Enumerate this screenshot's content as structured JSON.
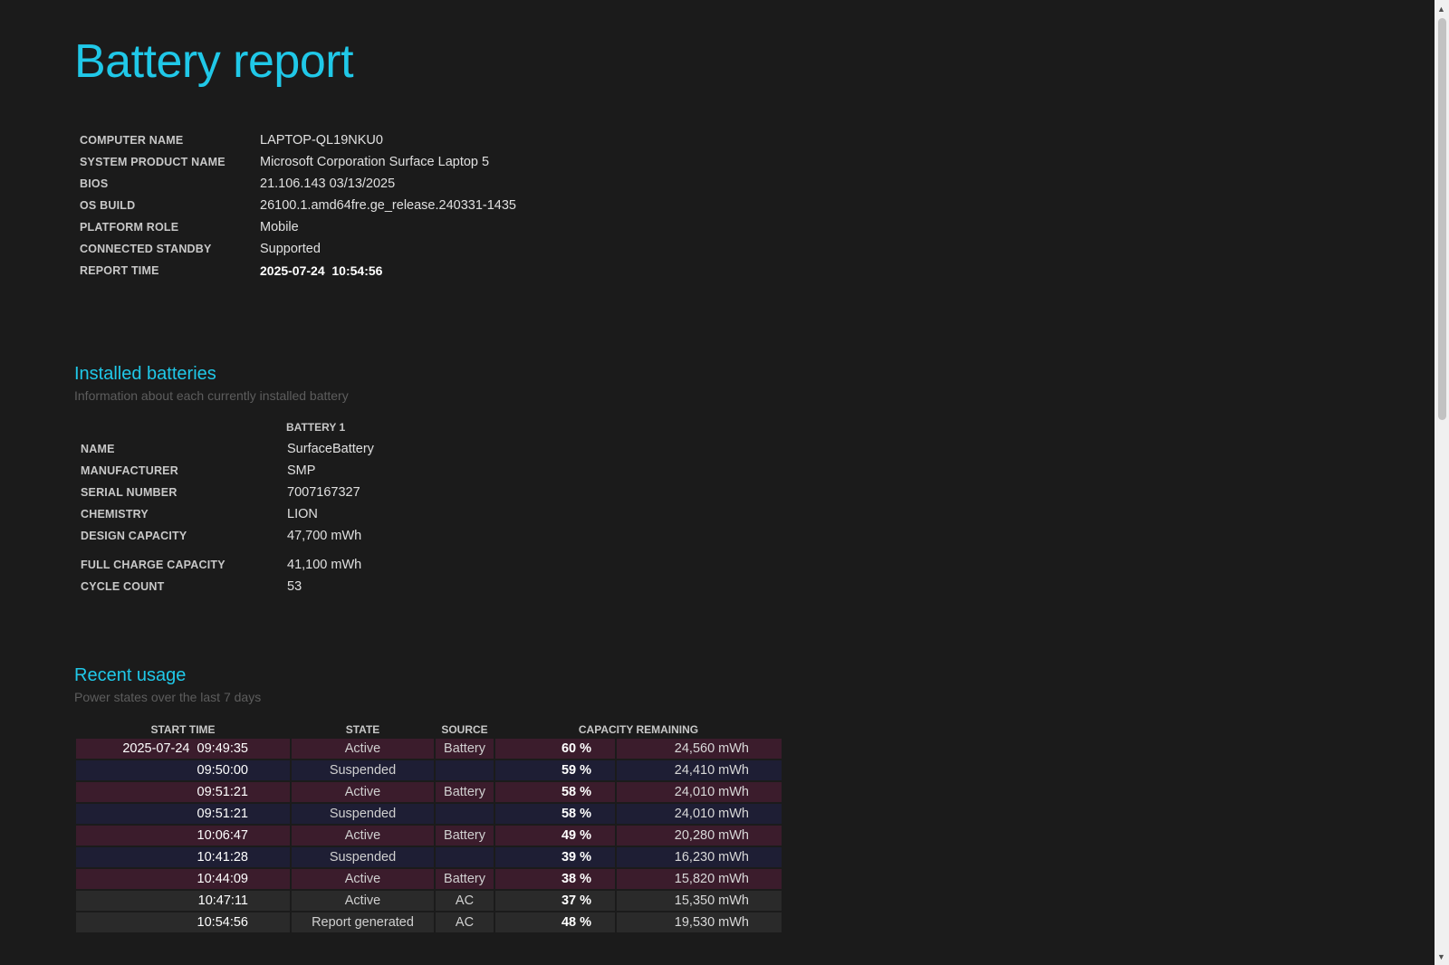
{
  "title": "Battery report",
  "system_info": [
    {
      "label": "COMPUTER NAME",
      "value": "LAPTOP-QL19NKU0"
    },
    {
      "label": "SYSTEM PRODUCT NAME",
      "value": "Microsoft Corporation Surface Laptop 5"
    },
    {
      "label": "BIOS",
      "value": "21.106.143 03/13/2025"
    },
    {
      "label": "OS BUILD",
      "value": "26100.1.amd64fre.ge_release.240331-1435"
    },
    {
      "label": "PLATFORM ROLE",
      "value": "Mobile"
    },
    {
      "label": "CONNECTED STANDBY",
      "value": "Supported"
    },
    {
      "label": "REPORT TIME",
      "value": "2025-07-24  10:54:56"
    }
  ],
  "installed_batteries": {
    "title": "Installed batteries",
    "subtitle": "Information about each currently installed battery",
    "column": "BATTERY 1",
    "rows": [
      {
        "label": "NAME",
        "value": "SurfaceBattery"
      },
      {
        "label": "MANUFACTURER",
        "value": "SMP"
      },
      {
        "label": "SERIAL NUMBER",
        "value": "7007167327"
      },
      {
        "label": "CHEMISTRY",
        "value": "LION"
      },
      {
        "label": "DESIGN CAPACITY",
        "value": "47,700 mWh"
      },
      {
        "label": "FULL CHARGE CAPACITY",
        "value": "41,100 mWh"
      },
      {
        "label": "CYCLE COUNT",
        "value": "53"
      }
    ]
  },
  "recent_usage": {
    "title": "Recent usage",
    "subtitle": "Power states over the last 7 days",
    "headers": {
      "start_time": "START TIME",
      "state": "STATE",
      "source": "SOURCE",
      "capacity": "CAPACITY REMAINING"
    },
    "rows": [
      {
        "start": "2025-07-24  09:49:35",
        "state": "Active",
        "source": "Battery",
        "pct": "60 %",
        "mwh": "24,560 mWh"
      },
      {
        "start": "09:50:00",
        "state": "Suspended",
        "source": "",
        "pct": "59 %",
        "mwh": "24,410 mWh"
      },
      {
        "start": "09:51:21",
        "state": "Active",
        "source": "Battery",
        "pct": "58 %",
        "mwh": "24,010 mWh"
      },
      {
        "start": "09:51:21",
        "state": "Suspended",
        "source": "",
        "pct": "58 %",
        "mwh": "24,010 mWh"
      },
      {
        "start": "10:06:47",
        "state": "Active",
        "source": "Battery",
        "pct": "49 %",
        "mwh": "20,280 mWh"
      },
      {
        "start": "10:41:28",
        "state": "Suspended",
        "source": "",
        "pct": "39 %",
        "mwh": "16,230 mWh"
      },
      {
        "start": "10:44:09",
        "state": "Active",
        "source": "Battery",
        "pct": "38 %",
        "mwh": "15,820 mWh"
      },
      {
        "start": "10:47:11",
        "state": "Active",
        "source": "AC",
        "pct": "37 %",
        "mwh": "15,350 mWh"
      },
      {
        "start": "10:54:56",
        "state": "Report generated",
        "source": "AC",
        "pct": "48 %",
        "mwh": "19,530 mWh"
      }
    ]
  },
  "colors": {
    "accent": "#20c8e8",
    "background": "#1b1b1b",
    "battery_row": "#3b1c2c",
    "suspended_row": "#1e1e34",
    "ac_row": "#2a2a2a"
  },
  "icons": {
    "scroll_up": "triangle-up",
    "scroll_down": "triangle-down"
  }
}
